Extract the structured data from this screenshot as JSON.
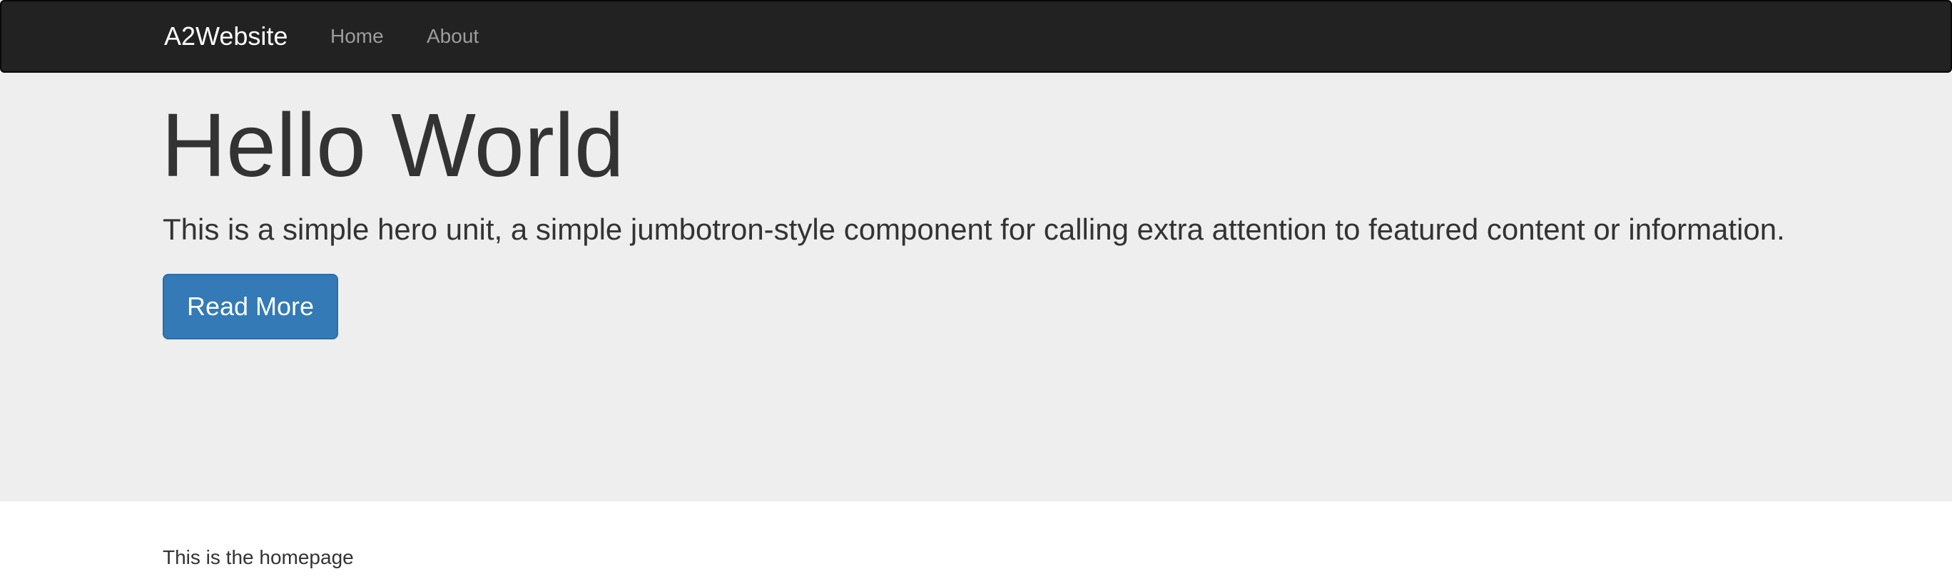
{
  "navbar": {
    "brand": "A2Website",
    "links": [
      {
        "label": "Home"
      },
      {
        "label": "About"
      }
    ]
  },
  "hero": {
    "title": "Hello World",
    "lead": "This is a simple hero unit, a simple jumbotron-style component for calling extra attention to featured content or information.",
    "button_label": "Read More"
  },
  "main": {
    "text": "This is the homepage"
  },
  "colors": {
    "navbar_bg": "#222222",
    "jumbotron_bg": "#eeeeee",
    "primary": "#337ab7",
    "text": "#333333",
    "nav_link": "#9d9d9d"
  }
}
